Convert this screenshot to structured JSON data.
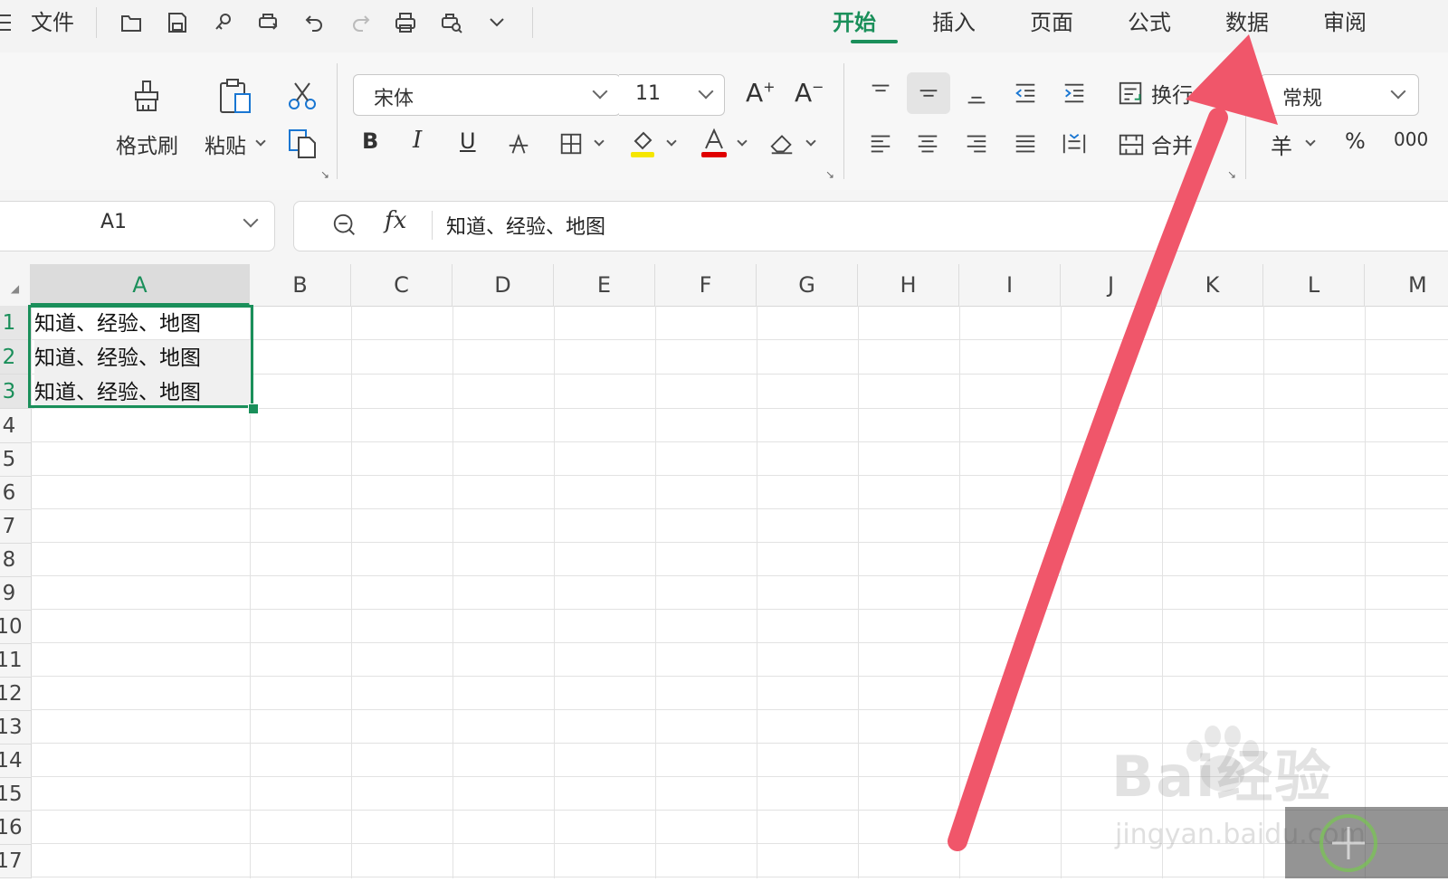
{
  "menu": {
    "file_label": "文件"
  },
  "tabs": [
    {
      "label": "开始",
      "active": true
    },
    {
      "label": "插入",
      "active": false
    },
    {
      "label": "页面",
      "active": false
    },
    {
      "label": "公式",
      "active": false
    },
    {
      "label": "数据",
      "active": false
    },
    {
      "label": "审阅",
      "active": false
    }
  ],
  "ribbon": {
    "format_painter": "格式刷",
    "paste": "粘贴",
    "font_name": "宋体",
    "font_size": "11",
    "grow_font": "A",
    "shrink_font": "A",
    "bold": "B",
    "italic": "I",
    "underline": "U",
    "wrap_text": "换行",
    "merge": "合并",
    "number_format": "常规",
    "currency": "羊",
    "percent": "%",
    "thousands": "000"
  },
  "formula_bar": {
    "cell_ref": "A1",
    "fx": "fx",
    "content": "知道、经验、地图"
  },
  "columns": [
    "A",
    "B",
    "C",
    "D",
    "E",
    "F",
    "G",
    "H",
    "I",
    "J",
    "K",
    "L",
    "M"
  ],
  "rows": [
    "1",
    "2",
    "3",
    "4",
    "5",
    "6",
    "7",
    "8",
    "9",
    "10",
    "11",
    "12",
    "13",
    "14",
    "15",
    "16",
    "17"
  ],
  "cells": {
    "A1": "知道、经验、地图",
    "A2": "知道、经验、地图",
    "A3": "知道、经验、地图"
  },
  "colors": {
    "accent": "#1a8f5a",
    "arrow": "#f0566a",
    "highlight": "#f5e600",
    "font_color": "#e00000"
  },
  "watermark": {
    "brand": "Bai经验",
    "url": "jingyan.baidu.com"
  }
}
